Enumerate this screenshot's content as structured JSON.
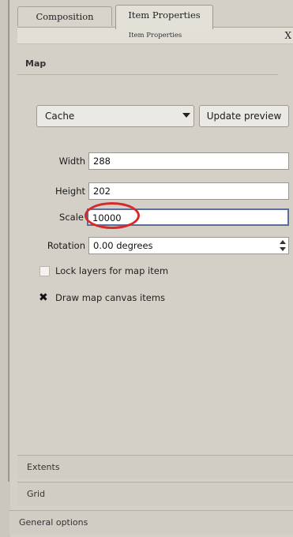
{
  "tabs": [
    {
      "label": "Composition"
    },
    {
      "label": "Item Properties"
    }
  ],
  "subheader": {
    "title": "Item Properties",
    "close_glyph": "X"
  },
  "map_section": {
    "title": "Map",
    "cache_select": {
      "value": "Cache"
    },
    "update_preview_label": "Update preview",
    "width_label": "Width",
    "width_value": "288",
    "height_label": "Height",
    "height_value": "202",
    "scale_label": "Scale",
    "scale_value": "10000",
    "rotation_label": "Rotation",
    "rotation_value": "0.00 degrees",
    "lock_layers_label": "Lock layers for map item",
    "lock_layers_checked": false,
    "draw_canvas_label": "Draw map canvas items",
    "draw_canvas_checked": true
  },
  "collapsed_sections": [
    {
      "title": "Extents"
    },
    {
      "title": "Grid"
    },
    {
      "title": "General options"
    }
  ],
  "annotation": {
    "highlight_color": "#d42a2a"
  }
}
